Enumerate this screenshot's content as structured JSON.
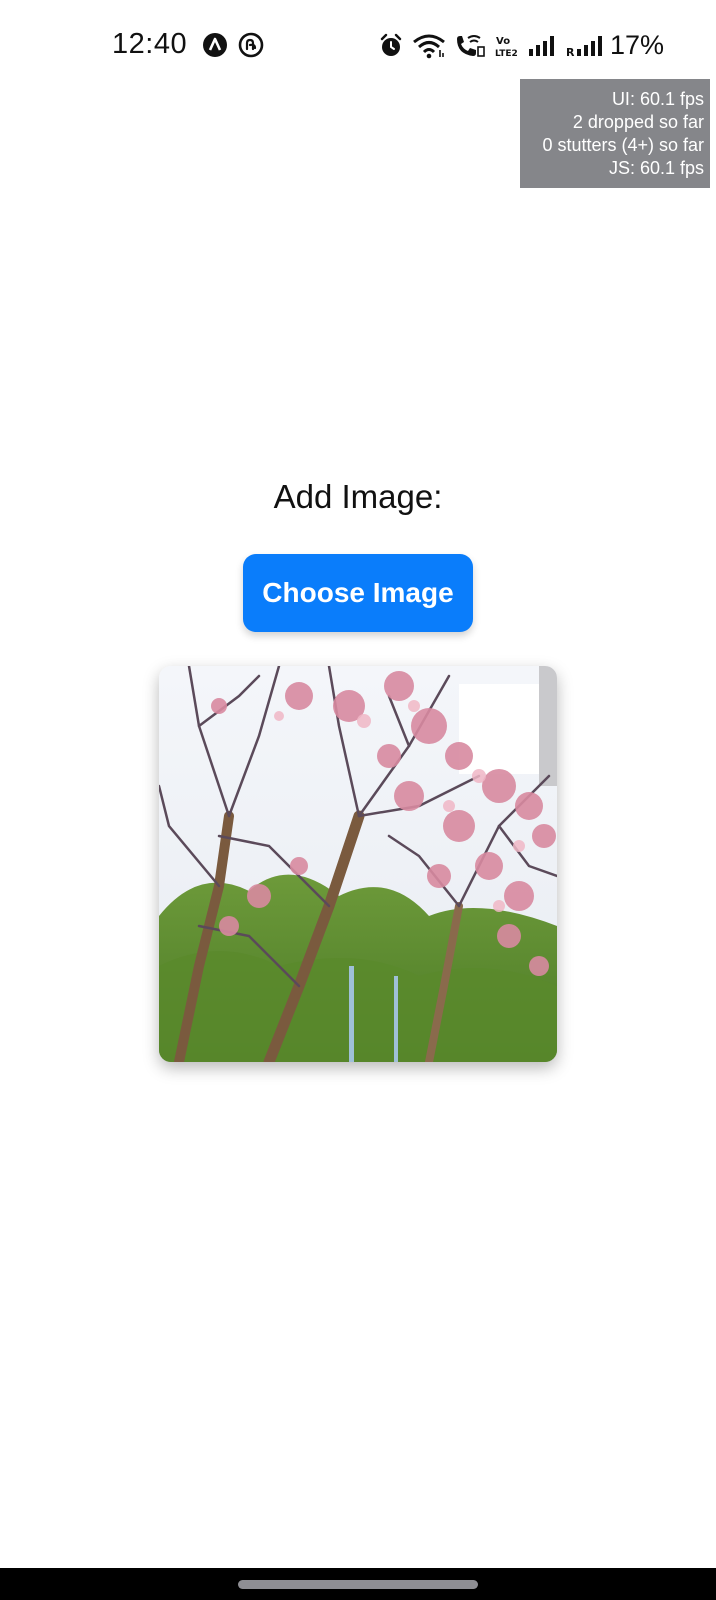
{
  "status_bar": {
    "time": "12:40",
    "notification_icons": [
      "app-a-icon",
      "app-swirl-icon"
    ],
    "system_icons": [
      "alarm-icon",
      "wifi-icon",
      "wifi-calling-icon",
      "volte-icon",
      "signal-icon",
      "roaming-signal-icon"
    ],
    "volte_label": "Vo LTE2",
    "roaming_label": "R",
    "battery": "17%"
  },
  "perf_monitor": {
    "ui_fps": "UI: 60.1 fps",
    "dropped": "2 dropped so far",
    "stutters": "0 stutters (4+) so far",
    "js_fps": "JS: 60.1 fps"
  },
  "main": {
    "heading": "Add Image:",
    "choose_button_label": "Choose Image",
    "image_description_icon": "photo-tree-blossoms"
  },
  "colors": {
    "accent": "#0a7dfb",
    "perf_bg": "#85868a",
    "text": "#111111"
  }
}
